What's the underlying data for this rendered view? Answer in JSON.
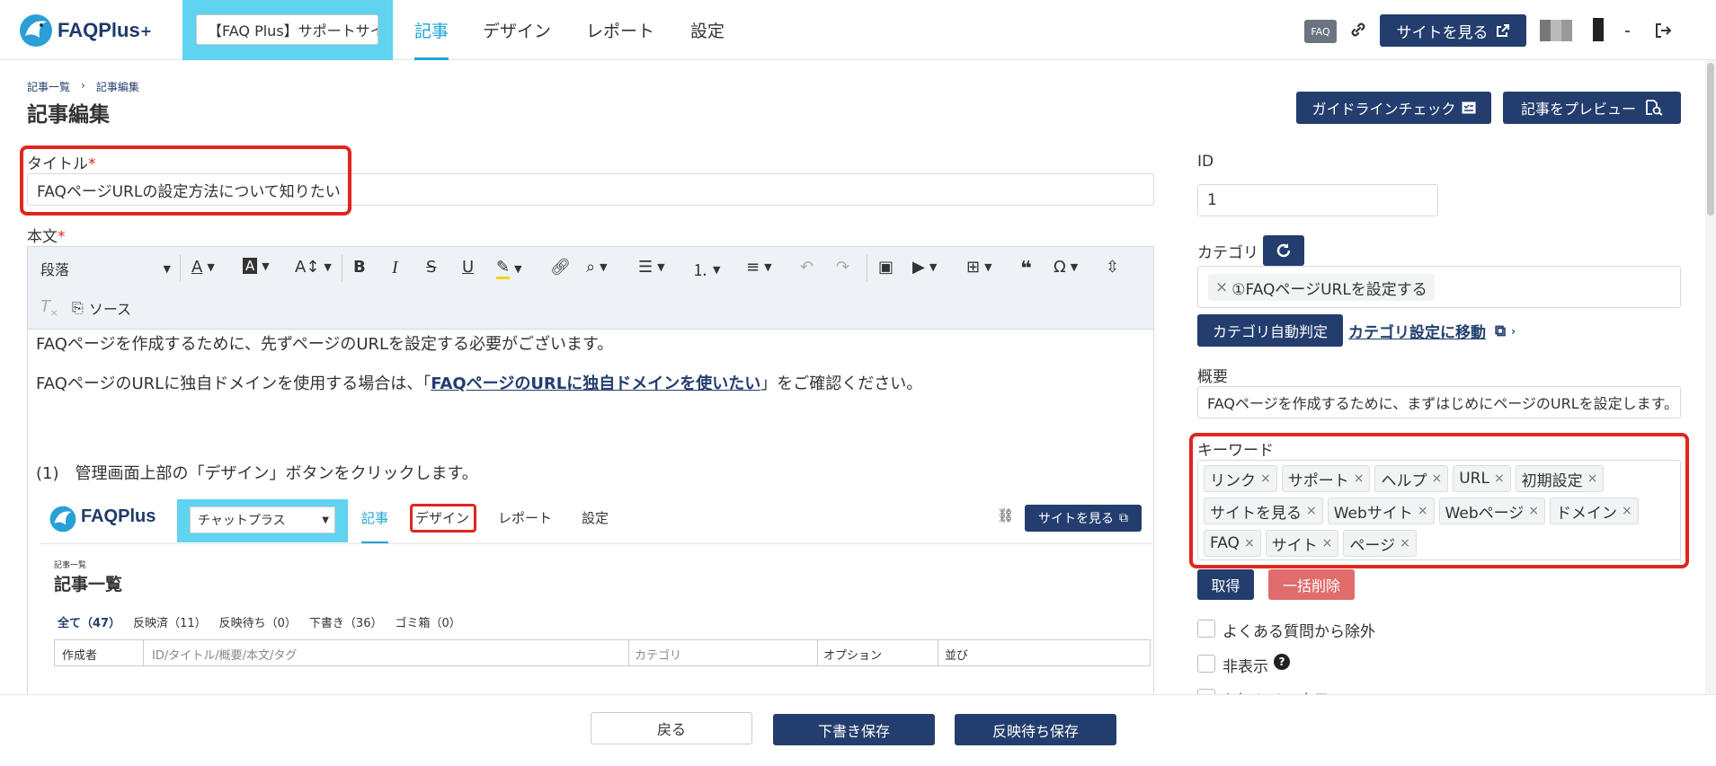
{
  "header": {
    "logo_text": "FAQPlus",
    "logo_plus": "+",
    "project_selector": "【FAQ Plus】サポートサイト",
    "nav": [
      "記事",
      "デザイン",
      "レポート",
      "設定"
    ],
    "faq_badge": "FAQ",
    "view_site_button": "サイトを見る"
  },
  "breadcrumb": {
    "item1": "記事一覧",
    "sep": "›",
    "item2": "記事編集"
  },
  "page_title": "記事編集",
  "actions": {
    "guideline_check": "ガイドラインチェック",
    "preview": "記事をプレビュー"
  },
  "title_field": {
    "label": "タイトル",
    "required": "*",
    "value": "FAQページURLの設定方法について知りたい"
  },
  "body_field": {
    "label": "本文",
    "required": "*"
  },
  "editor": {
    "block_format": "段落",
    "source_button": "ソース",
    "para1": "FAQページを作成するために、先ずページのURLを設定する必要がございます。",
    "para2_prefix": "FAQページのURLに独自ドメインを使用する場合は、「",
    "para2_link": "FAQページのURLに独自ドメインを使いたい",
    "para2_suffix": "」をご確認ください。",
    "step1": "(1)　管理画面上部の「デザイン」ボタンをクリックします。"
  },
  "embedded": {
    "logo_text": "FAQPlus",
    "selector": "チャットプラス",
    "nav": [
      "記事",
      "デザイン",
      "レポート",
      "設定"
    ],
    "view_site": "サイトを見る",
    "breadcrumb": "記事一覧",
    "title": "記事一覧",
    "filters": [
      "全て（47）",
      "反映済（11）",
      "反映待ち（0）",
      "下書き（36）",
      "ゴミ箱（0）"
    ],
    "columns": [
      "作成者",
      "ID/タイトル/概要/本文/タグ",
      "カテゴリ",
      "オプション",
      "並び"
    ]
  },
  "sidebar": {
    "id_label": "ID",
    "id_value": "1",
    "category_label": "カテゴリ",
    "category_tag": "①FAQページURLを設定する",
    "category_auto_button": "カテゴリ自動判定",
    "category_settings_link": "カテゴリ設定に移動",
    "summary_label": "概要",
    "summary_value": "FAQページを作成するために、まずはじめにページのURLを設定します。",
    "keywords_label": "キーワード",
    "keywords": [
      "リンク",
      "サポート",
      "ヘルプ",
      "URL",
      "初期設定",
      "サイトを見る",
      "Webサイト",
      "Webページ",
      "ドメイン",
      "FAQ",
      "サイト",
      "ページ"
    ],
    "fetch_button": "取得",
    "bulk_delete_button": "一括削除",
    "exclude_faq": "よくある質問から除外",
    "hidden": "非表示",
    "notice": "お知らせに表示"
  },
  "footer": {
    "back": "戻る",
    "draft_save": "下書き保存",
    "pending_save": "反映待ち保存"
  },
  "colors": {
    "navy": "#233e6e",
    "accent": "#1aa6d6",
    "selector_bg": "#5fd3f0",
    "highlight": "#e0261d",
    "danger": "#e06c6c"
  }
}
